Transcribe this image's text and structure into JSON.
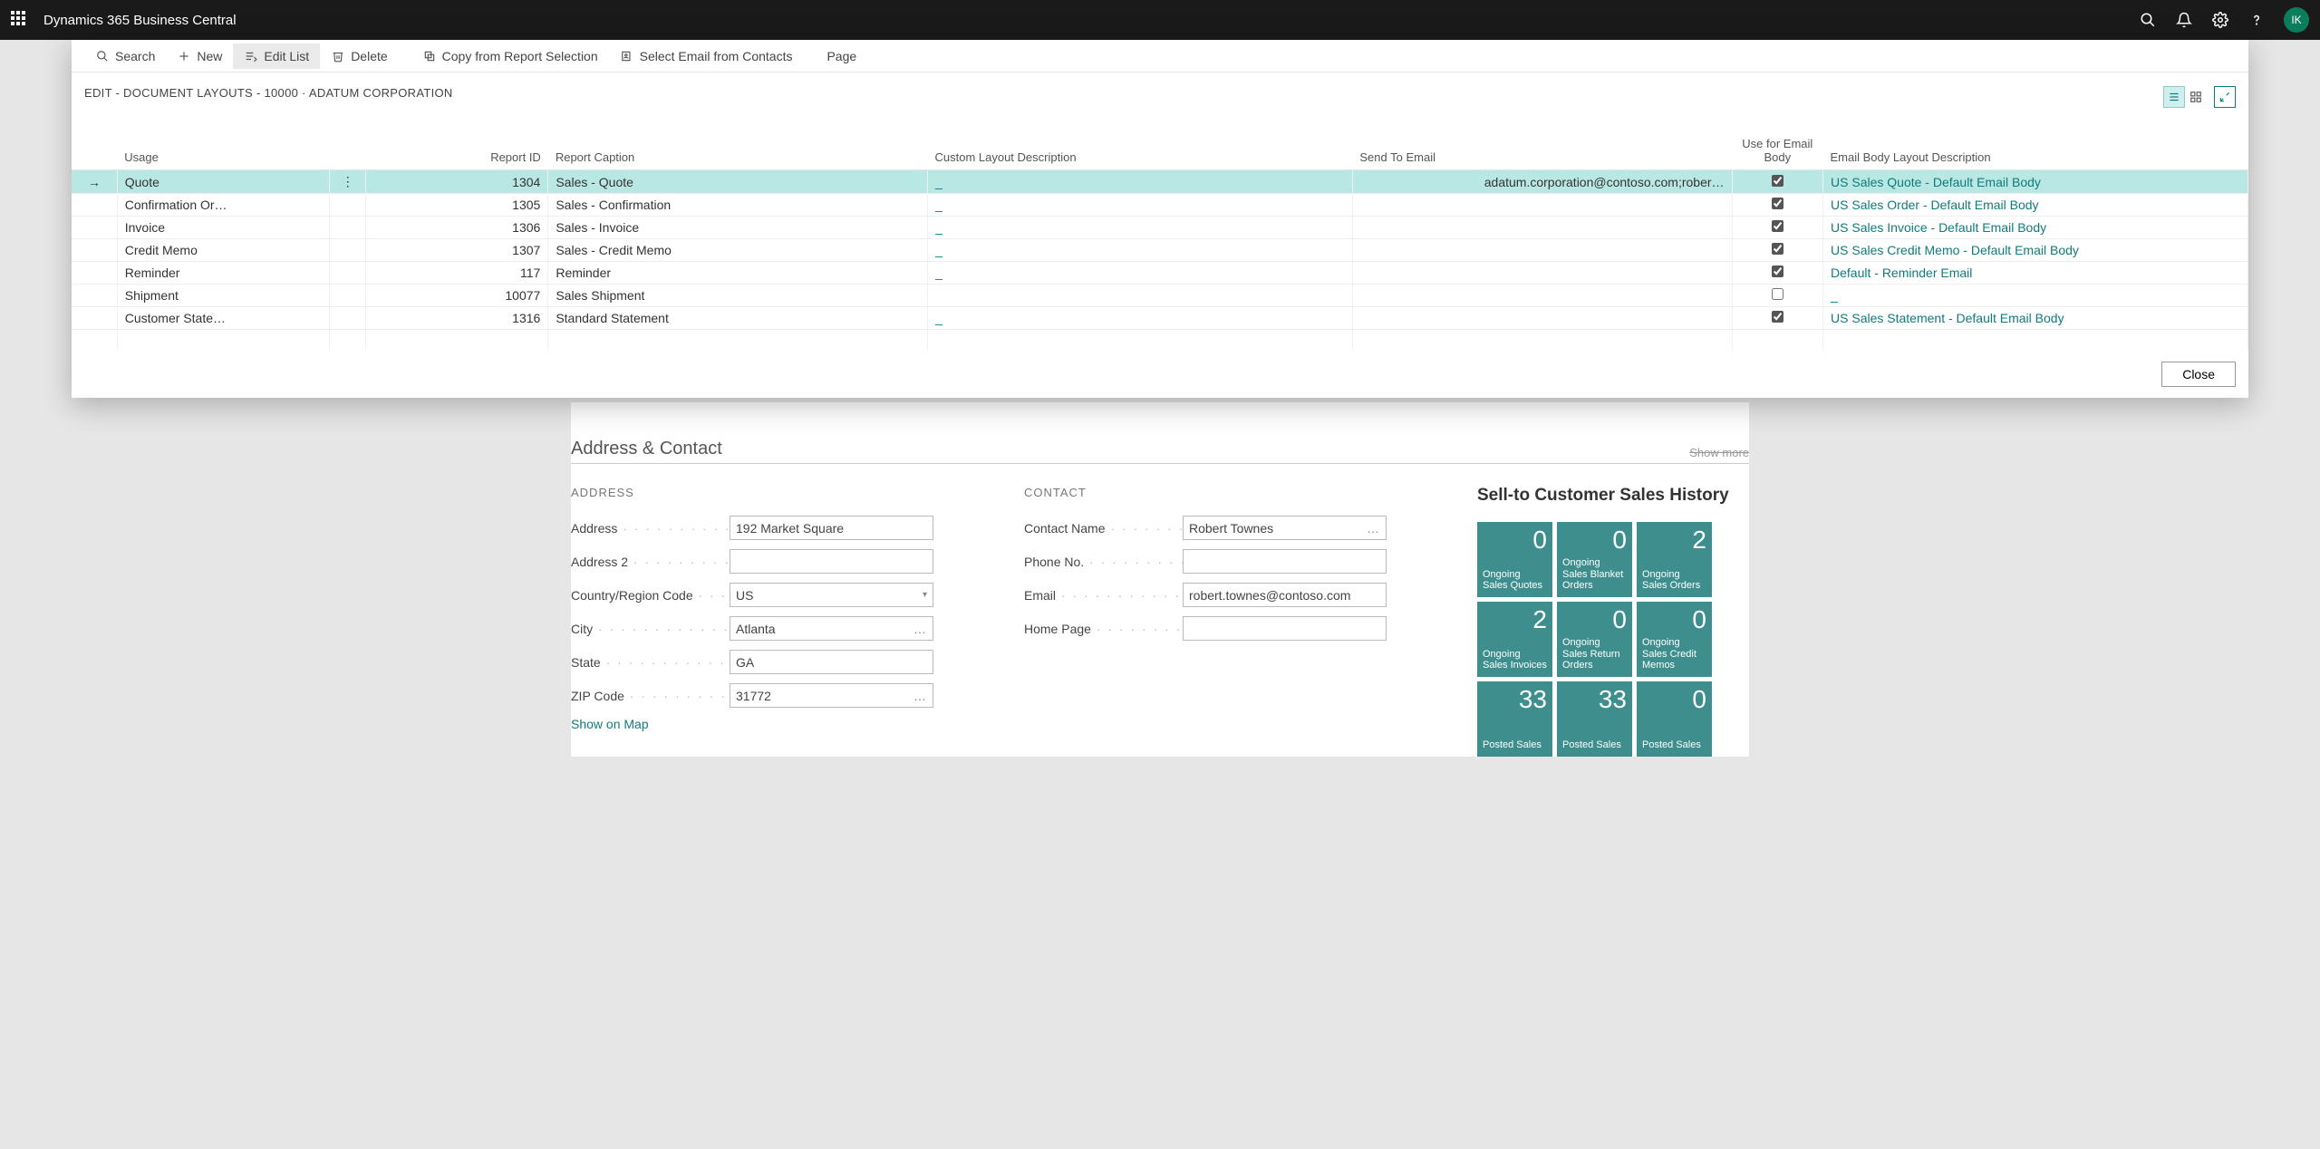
{
  "app": {
    "title": "Dynamics 365 Business Central",
    "avatar": "IK"
  },
  "toolbar": {
    "search": "Search",
    "new": "New",
    "edit_list": "Edit List",
    "delete": "Delete",
    "copy_from": "Copy from Report Selection",
    "select_email": "Select Email from Contacts",
    "page": "Page"
  },
  "dialog": {
    "title": "EDIT - DOCUMENT LAYOUTS - 10000 · ADATUM CORPORATION",
    "close": "Close"
  },
  "grid": {
    "headers": {
      "usage": "Usage",
      "report_id": "Report ID",
      "report_caption": "Report Caption",
      "custom_layout": "Custom Layout Description",
      "send_to": "Send To Email",
      "use_for": "Use for Email Body",
      "body_desc": "Email Body Layout Description"
    },
    "rows": [
      {
        "usage": "Quote",
        "report_id": "1304",
        "caption": "Sales - Quote",
        "custom": "_",
        "send_to": "adatum.corporation@contoso.com;rober…",
        "use_for": true,
        "body": "US Sales Quote - Default Email Body"
      },
      {
        "usage": "Confirmation Or…",
        "report_id": "1305",
        "caption": "Sales - Confirmation",
        "custom": "_",
        "send_to": "",
        "use_for": true,
        "body": "US Sales Order - Default Email Body"
      },
      {
        "usage": "Invoice",
        "report_id": "1306",
        "caption": "Sales - Invoice",
        "custom": "_",
        "send_to": "",
        "use_for": true,
        "body": "US Sales Invoice - Default Email Body"
      },
      {
        "usage": "Credit Memo",
        "report_id": "1307",
        "caption": "Sales - Credit Memo",
        "custom": "_",
        "send_to": "",
        "use_for": true,
        "body": "US Sales Credit Memo - Default Email Body"
      },
      {
        "usage": "Reminder",
        "report_id": "117",
        "caption": "Reminder",
        "custom": "_",
        "send_to": "",
        "use_for": true,
        "body": "Default - Reminder Email"
      },
      {
        "usage": "Shipment",
        "report_id": "10077",
        "caption": "Sales Shipment",
        "custom": "",
        "send_to": "",
        "use_for": false,
        "body": "_"
      },
      {
        "usage": "Customer State…",
        "report_id": "1316",
        "caption": "Standard Statement",
        "custom": "_",
        "send_to": "",
        "use_for": true,
        "body": "US Sales Statement - Default Email Body"
      }
    ]
  },
  "background": {
    "section_title": "Address & Contact",
    "show_more": "Show more",
    "address_group": "ADDRESS",
    "contact_group": "CONTACT",
    "labels": {
      "address": "Address",
      "address2": "Address 2",
      "country": "Country/Region Code",
      "city": "City",
      "state": "State",
      "zip": "ZIP Code",
      "contact_name": "Contact Name",
      "phone": "Phone No.",
      "email": "Email",
      "home_page": "Home Page"
    },
    "values": {
      "address": "192 Market Square",
      "address2": "",
      "country": "US",
      "city": "Atlanta",
      "state": "GA",
      "zip": "31772",
      "contact_name": "Robert Townes",
      "phone": "",
      "email": "robert.townes@contoso.com",
      "home_page": ""
    },
    "show_on_map": "Show on Map",
    "sales_history_title": "Sell-to Customer Sales History",
    "tiles": [
      {
        "n": "0",
        "label": "Ongoing Sales Quotes"
      },
      {
        "n": "0",
        "label": "Ongoing Sales Blanket Orders"
      },
      {
        "n": "2",
        "label": "Ongoing Sales Orders"
      },
      {
        "n": "2",
        "label": "Ongoing Sales Invoices"
      },
      {
        "n": "0",
        "label": "Ongoing Sales Return Orders"
      },
      {
        "n": "0",
        "label": "Ongoing Sales Credit Memos"
      },
      {
        "n": "33",
        "label": "Posted Sales"
      },
      {
        "n": "33",
        "label": "Posted Sales"
      },
      {
        "n": "0",
        "label": "Posted Sales"
      }
    ]
  }
}
